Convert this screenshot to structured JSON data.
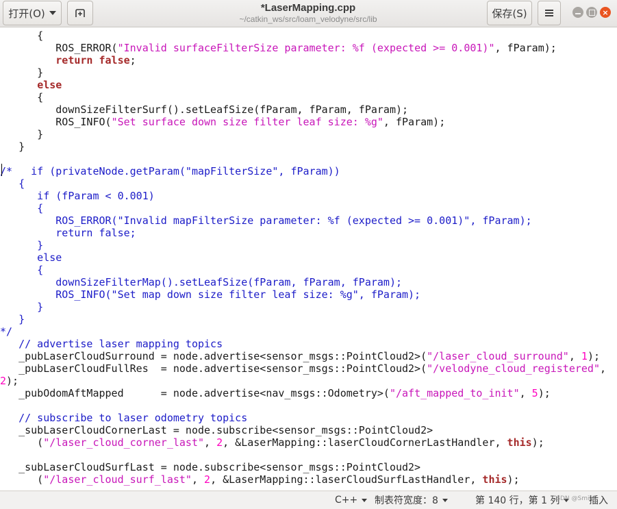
{
  "header": {
    "open_label": "打开(O)",
    "save_label": "保存(S)",
    "title": "*LaserMapping.cpp",
    "path": "~/catkin_ws/src/loam_velodyne/src/lib"
  },
  "icons": {
    "new_tab": "new-tab-icon",
    "menu": "hamburger-menu-icon",
    "minimize": "minimize-icon",
    "maximize": "maximize-icon",
    "close": "close-icon"
  },
  "colors": {
    "string": "#c816b9",
    "keyword": "#a52a2a",
    "number": "#ff00c0",
    "comment": "#1c1cc8",
    "close_button": "#e95420"
  },
  "code_lines": [
    [
      {
        "t": "      {",
        "c": ""
      }
    ],
    [
      {
        "t": "         ROS_ERROR(",
        "c": ""
      },
      {
        "t": "\"Invalid surfaceFilterSize parameter: %f (expected >= 0.001)\"",
        "c": "str"
      },
      {
        "t": ", fParam);",
        "c": ""
      }
    ],
    [
      {
        "t": "         ",
        "c": ""
      },
      {
        "t": "return",
        "c": "kw"
      },
      {
        "t": " ",
        "c": ""
      },
      {
        "t": "false",
        "c": "kw"
      },
      {
        "t": ";",
        "c": ""
      }
    ],
    [
      {
        "t": "      }",
        "c": ""
      }
    ],
    [
      {
        "t": "      ",
        "c": ""
      },
      {
        "t": "else",
        "c": "kw"
      }
    ],
    [
      {
        "t": "      {",
        "c": ""
      }
    ],
    [
      {
        "t": "         downSizeFilterSurf().setLeafSize(fParam, fParam, fParam);",
        "c": ""
      }
    ],
    [
      {
        "t": "         ROS_INFO(",
        "c": ""
      },
      {
        "t": "\"Set surface down size filter leaf size: %g\"",
        "c": "str"
      },
      {
        "t": ", fParam);",
        "c": ""
      }
    ],
    [
      {
        "t": "      }",
        "c": ""
      }
    ],
    [
      {
        "t": "   }",
        "c": ""
      }
    ],
    [
      {
        "t": "",
        "c": ""
      }
    ],
    [
      {
        "t": "/*   if (privateNode.getParam(\"mapFilterSize\", fParam))",
        "c": "cm"
      }
    ],
    [
      {
        "t": "   {",
        "c": "cm"
      }
    ],
    [
      {
        "t": "      if (fParam < 0.001)",
        "c": "cm"
      }
    ],
    [
      {
        "t": "      {",
        "c": "cm"
      }
    ],
    [
      {
        "t": "         ROS_ERROR(\"Invalid mapFilterSize parameter: %f (expected >= 0.001)\", fParam);",
        "c": "cm"
      }
    ],
    [
      {
        "t": "         return false;",
        "c": "cm"
      }
    ],
    [
      {
        "t": "      }",
        "c": "cm"
      }
    ],
    [
      {
        "t": "      else",
        "c": "cm"
      }
    ],
    [
      {
        "t": "      {",
        "c": "cm"
      }
    ],
    [
      {
        "t": "         downSizeFilterMap().setLeafSize(fParam, fParam, fParam);",
        "c": "cm"
      }
    ],
    [
      {
        "t": "         ROS_INFO(\"Set map down size filter leaf size: %g\", fParam);",
        "c": "cm"
      }
    ],
    [
      {
        "t": "      }",
        "c": "cm"
      }
    ],
    [
      {
        "t": "   }",
        "c": "cm"
      }
    ],
    [
      {
        "t": "*/",
        "c": "cm"
      }
    ],
    [
      {
        "t": "   // advertise laser mapping topics",
        "c": "cm"
      }
    ],
    [
      {
        "t": "   _pubLaserCloudSurround = node.advertise<sensor_msgs::PointCloud2>(",
        "c": ""
      },
      {
        "t": "\"/laser_cloud_surround\"",
        "c": "str"
      },
      {
        "t": ", ",
        "c": ""
      },
      {
        "t": "1",
        "c": "num"
      },
      {
        "t": ");",
        "c": ""
      }
    ],
    [
      {
        "t": "   _pubLaserCloudFullRes  = node.advertise<sensor_msgs::PointCloud2>(",
        "c": ""
      },
      {
        "t": "\"/velodyne_cloud_registered\"",
        "c": "str"
      },
      {
        "t": ",",
        "c": ""
      }
    ],
    [
      {
        "t": "2",
        "c": "num"
      },
      {
        "t": ");",
        "c": ""
      }
    ],
    [
      {
        "t": "   _pubOdomAftMapped      = node.advertise<nav_msgs::Odometry>(",
        "c": ""
      },
      {
        "t": "\"/aft_mapped_to_init\"",
        "c": "str"
      },
      {
        "t": ", ",
        "c": ""
      },
      {
        "t": "5",
        "c": "num"
      },
      {
        "t": ");",
        "c": ""
      }
    ],
    [
      {
        "t": "",
        "c": ""
      }
    ],
    [
      {
        "t": "   // subscribe to laser odometry topics",
        "c": "cm"
      }
    ],
    [
      {
        "t": "   _subLaserCloudCornerLast = node.subscribe<sensor_msgs::PointCloud2>",
        "c": ""
      }
    ],
    [
      {
        "t": "      (",
        "c": ""
      },
      {
        "t": "\"/laser_cloud_corner_last\"",
        "c": "str"
      },
      {
        "t": ", ",
        "c": ""
      },
      {
        "t": "2",
        "c": "num"
      },
      {
        "t": ", &LaserMapping::laserCloudCornerLastHandler, ",
        "c": ""
      },
      {
        "t": "this",
        "c": "kw"
      },
      {
        "t": ");",
        "c": ""
      }
    ],
    [
      {
        "t": "",
        "c": ""
      }
    ],
    [
      {
        "t": "   _subLaserCloudSurfLast = node.subscribe<sensor_msgs::PointCloud2>",
        "c": ""
      }
    ],
    [
      {
        "t": "      (",
        "c": ""
      },
      {
        "t": "\"/laser_cloud_surf_last\"",
        "c": "str"
      },
      {
        "t": ", ",
        "c": ""
      },
      {
        "t": "2",
        "c": "num"
      },
      {
        "t": ", &LaserMapping::laserCloudSurfLastHandler, ",
        "c": ""
      },
      {
        "t": "this",
        "c": "kw"
      },
      {
        "t": ");",
        "c": ""
      }
    ]
  ],
  "status": {
    "language": "C++",
    "tab_width": "制表符宽度：8",
    "position": "第 140 行，第 1 列",
    "mode": "插入",
    "watermark": "CSDN @Smile"
  }
}
